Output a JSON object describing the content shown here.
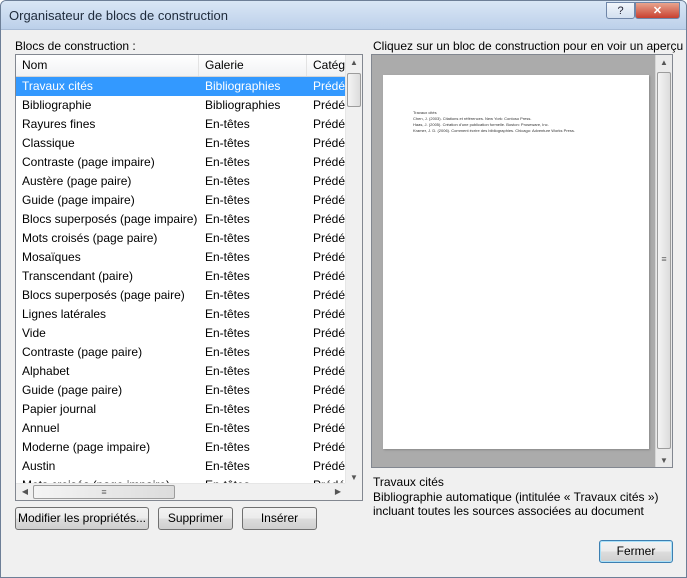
{
  "window": {
    "title": "Organisateur de blocs de construction",
    "help_label": "?",
    "close_label": "✕"
  },
  "left_label": "Blocs de construction :",
  "columns": [
    "Nom",
    "Galerie",
    "Catégorie"
  ],
  "rows": [
    {
      "name": "Travaux cités",
      "gallery": "Bibliographies",
      "category": "Prédéfini",
      "selected": true
    },
    {
      "name": "Bibliographie",
      "gallery": "Bibliographies",
      "category": "Prédéfini"
    },
    {
      "name": "Rayures fines",
      "gallery": "En-têtes",
      "category": "Prédéfini"
    },
    {
      "name": "Classique",
      "gallery": "En-têtes",
      "category": "Prédéfini"
    },
    {
      "name": "Contraste (page impaire)",
      "gallery": "En-têtes",
      "category": "Prédéfini"
    },
    {
      "name": "Austère (page paire)",
      "gallery": "En-têtes",
      "category": "Prédéfini"
    },
    {
      "name": "Guide (page impaire)",
      "gallery": "En-têtes",
      "category": "Prédéfini"
    },
    {
      "name": "Blocs superposés (page impaire)",
      "gallery": "En-têtes",
      "category": "Prédéfini"
    },
    {
      "name": "Mots croisés (page paire)",
      "gallery": "En-têtes",
      "category": "Prédéfini"
    },
    {
      "name": "Mosaïques",
      "gallery": "En-têtes",
      "category": "Prédéfini"
    },
    {
      "name": "Transcendant (paire)",
      "gallery": "En-têtes",
      "category": "Prédéfini"
    },
    {
      "name": "Blocs superposés (page paire)",
      "gallery": "En-têtes",
      "category": "Prédéfini"
    },
    {
      "name": "Lignes latérales",
      "gallery": "En-têtes",
      "category": "Prédéfini"
    },
    {
      "name": "Vide",
      "gallery": "En-têtes",
      "category": "Prédéfini"
    },
    {
      "name": "Contraste (page paire)",
      "gallery": "En-têtes",
      "category": "Prédéfini"
    },
    {
      "name": "Alphabet",
      "gallery": "En-têtes",
      "category": "Prédéfini"
    },
    {
      "name": "Guide (page paire)",
      "gallery": "En-têtes",
      "category": "Prédéfini"
    },
    {
      "name": "Papier journal",
      "gallery": "En-têtes",
      "category": "Prédéfini"
    },
    {
      "name": "Annuel",
      "gallery": "En-têtes",
      "category": "Prédéfini"
    },
    {
      "name": "Moderne (page impaire)",
      "gallery": "En-têtes",
      "category": "Prédéfini"
    },
    {
      "name": "Austin",
      "gallery": "En-têtes",
      "category": "Prédéfini"
    },
    {
      "name": "Mots croisés (page impaire)",
      "gallery": "En-têtes",
      "category": "Prédéfini"
    }
  ],
  "buttons": {
    "modify": "Modifier les propriétés...",
    "delete": "Supprimer",
    "insert": "Insérer",
    "close": "Fermer"
  },
  "preview": {
    "heading": "Cliquez sur un bloc de construction pour en voir un aperçu",
    "page_lines": [
      "Travaux cités",
      "Chen, J. (2003). Citations et références. New York: Contoso Press.",
      "Haas, J. (2005). Création d'une publication formelle. Boston: Proseware, Inc.",
      "Kramer, J. D. (2006). Comment écrire des bibliographies. Chicago: Adventure Works Press."
    ],
    "selected_name": "Travaux cités",
    "description": "Bibliographie automatique (intitulée « Travaux cités ») incluant toutes les sources associées au document"
  },
  "icons": {
    "scroll_up": "▲",
    "scroll_down": "▼",
    "scroll_left": "◀",
    "scroll_right": "▶",
    "grip": "≡"
  }
}
